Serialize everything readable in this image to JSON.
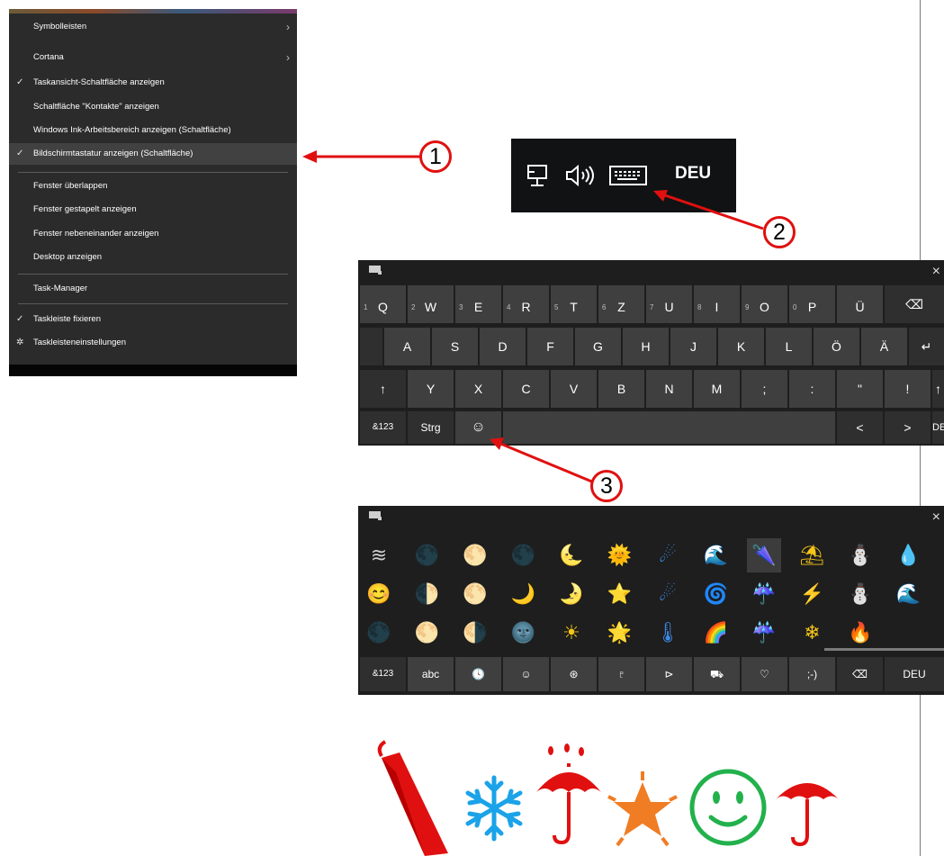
{
  "context_menu": {
    "items": [
      {
        "label": "Symbolleisten",
        "checked": false,
        "submenu": true
      },
      {
        "label": "Cortana",
        "checked": false,
        "submenu": true
      },
      {
        "label": "Taskansicht-Schaltfläche anzeigen",
        "checked": true,
        "submenu": false
      },
      {
        "label": "Schaltfläche \"Kontakte\" anzeigen",
        "checked": false,
        "submenu": false
      },
      {
        "label": "Windows Ink-Arbeitsbereich anzeigen (Schaltfläche)",
        "checked": false,
        "submenu": false
      },
      {
        "label": "Bildschirmtastatur anzeigen (Schaltfläche)",
        "checked": true,
        "submenu": false,
        "highlighted": true
      },
      {
        "label": "Fenster überlappen",
        "checked": false,
        "submenu": false
      },
      {
        "label": "Fenster gestapelt anzeigen",
        "checked": false,
        "submenu": false
      },
      {
        "label": "Fenster nebeneinander anzeigen",
        "checked": false,
        "submenu": false
      },
      {
        "label": "Desktop anzeigen",
        "checked": false,
        "submenu": false
      },
      {
        "label": "Task-Manager",
        "checked": false,
        "submenu": false
      },
      {
        "label": "Taskleiste fixieren",
        "checked": true,
        "submenu": false
      },
      {
        "label": "Taskleisteneinstellungen",
        "checked": false,
        "submenu": false,
        "icon": "gear-icon"
      }
    ]
  },
  "callouts": {
    "one": "1",
    "two": "2",
    "three": "3"
  },
  "tray": {
    "icons": [
      "network-icon",
      "speaker-icon",
      "touch-keyboard-icon"
    ],
    "language": "DEU"
  },
  "keyboard": {
    "row1": [
      {
        "k": "Q",
        "n": "1"
      },
      {
        "k": "W",
        "n": "2"
      },
      {
        "k": "E",
        "n": "3"
      },
      {
        "k": "R",
        "n": "4"
      },
      {
        "k": "T",
        "n": "5"
      },
      {
        "k": "Z",
        "n": "6"
      },
      {
        "k": "U",
        "n": "7"
      },
      {
        "k": "I",
        "n": "8"
      },
      {
        "k": "O",
        "n": "9"
      },
      {
        "k": "P",
        "n": "0"
      },
      {
        "k": "Ü",
        "n": ""
      }
    ],
    "backspace": "⌫",
    "row2": [
      "A",
      "S",
      "D",
      "F",
      "G",
      "H",
      "J",
      "K",
      "L",
      "Ö",
      "Ä"
    ],
    "enter": "↵",
    "shift": "↑",
    "row3": [
      "Y",
      "X",
      "C",
      "V",
      "B",
      "N",
      "M",
      ";",
      ":",
      "\"",
      "!"
    ],
    "row4": {
      "sym": "&123",
      "ctrl": "Strg",
      "emoji": "☺",
      "left": "<",
      "right": ">",
      "lang": "DEU"
    },
    "close": "×"
  },
  "emoji_panel": {
    "rows": [
      [
        "≋",
        "🌑",
        "🌕",
        "🌑",
        "🌜",
        "🌞",
        "☄",
        "🌊",
        "🌂",
        "⛱",
        "⛄",
        "💧"
      ],
      [
        "😊",
        "🌓",
        "🌕",
        "🌙",
        "🌛",
        "⭐",
        "☄",
        "🌀",
        "☔",
        "⚡",
        "⛄",
        "🌊"
      ],
      [
        "🌑",
        "🌕",
        "🌗",
        "🌚",
        "☀",
        "🌟",
        "🌡",
        "🌈",
        "☔",
        "❄",
        "🔥",
        ""
      ]
    ],
    "bottom": [
      "&123",
      "abc",
      "🕓",
      "☺",
      "⊛",
      "♇",
      "⊳",
      "⛟",
      "♡",
      ";-)",
      "⌫",
      "DEU"
    ],
    "close": "×"
  },
  "colors": {
    "accent_red": "#e01010",
    "menu_bg": "#2b2b2b",
    "key_bg": "#3f3f3f"
  }
}
